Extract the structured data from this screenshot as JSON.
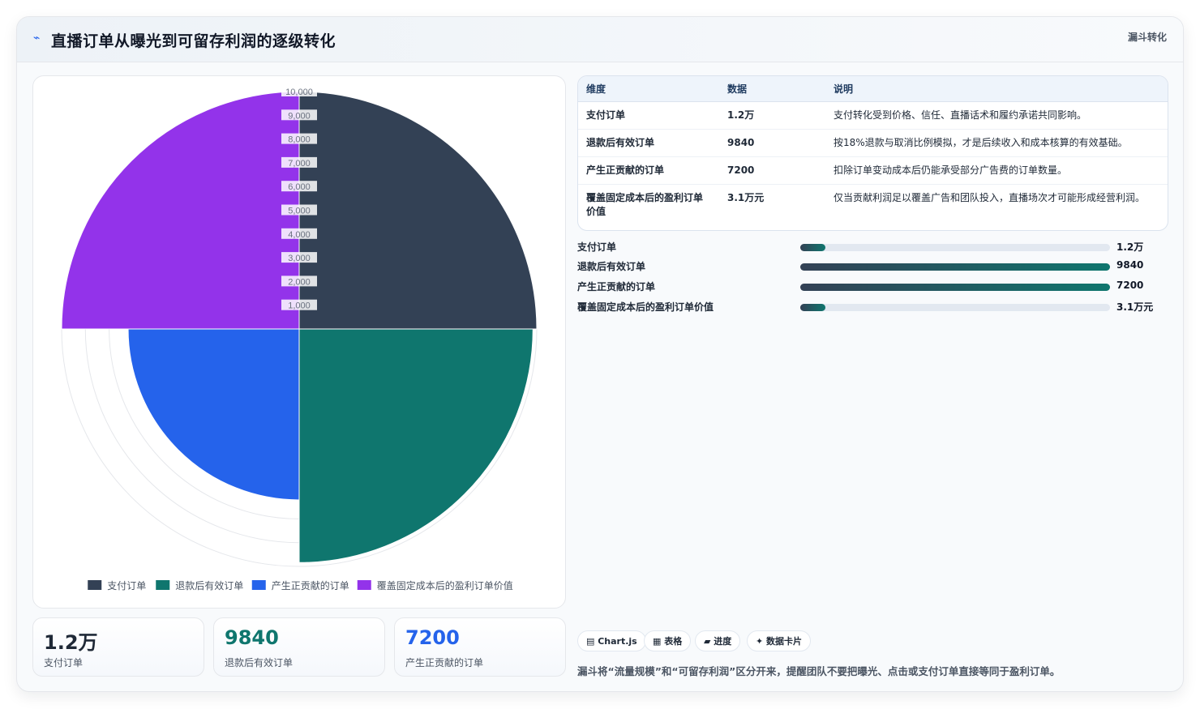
{
  "header": {
    "icon": "chart-icon",
    "title": "直播订单从曝光到可留存利润的逐级转化",
    "badge": "漏斗转化"
  },
  "colors": {
    "series": [
      "#334155",
      "#0f766e",
      "#2563eb",
      "#9333ea"
    ]
  },
  "chart_data": {
    "type": "polar-area",
    "categories": [
      "支付订单",
      "退款后有效订单",
      "产生正贡献的订单",
      "覆盖固定成本后的盈利订单价值"
    ],
    "values": [
      12000,
      9840,
      7200,
      31000
    ],
    "r_ticks": [
      "1,000",
      "2,000",
      "3,000",
      "4,000",
      "5,000",
      "6,000",
      "7,000",
      "8,000",
      "9,000",
      "10,000"
    ],
    "r_max": 10000,
    "legend_position": "bottom"
  },
  "legend": [
    {
      "label": "支付订单",
      "color": "#334155"
    },
    {
      "label": "退款后有效订单",
      "color": "#0f766e"
    },
    {
      "label": "产生正贡献的订单",
      "color": "#2563eb"
    },
    {
      "label": "覆盖固定成本后的盈利订单价值",
      "color": "#9333ea"
    }
  ],
  "stats": [
    {
      "value": "1.2万",
      "label": "支付订单",
      "color": "#1f2937"
    },
    {
      "value": "9840",
      "label": "退款后有效订单",
      "color": "#0f766e"
    },
    {
      "value": "7200",
      "label": "产生正贡献的订单",
      "color": "#2563eb"
    }
  ],
  "table": {
    "headers": [
      "维度",
      "数据",
      "说明"
    ],
    "rows": [
      [
        "支付订单",
        "1.2万",
        "支付转化受到价格、信任、直播话术和履约承诺共同影响。"
      ],
      [
        "退款后有效订单",
        "9840",
        "按18%退款与取消比例模拟，才是后续收入和成本核算的有效基础。"
      ],
      [
        "产生正贡献的订单",
        "7200",
        "扣除订单变动成本后仍能承受部分广告费的订单数量。"
      ],
      [
        "覆盖固定成本后的盈利订单价值",
        "3.1万元",
        "仅当贡献利润足以覆盖广告和团队投入，直播场次才可能形成经营利润。"
      ]
    ]
  },
  "bars": [
    {
      "label": "支付订单",
      "value": "1.2万",
      "fill": 0.08
    },
    {
      "label": "退款后有效订单",
      "value": "9840",
      "fill": 1.0
    },
    {
      "label": "产生正贡献的订单",
      "value": "7200",
      "fill": 1.0
    },
    {
      "label": "覆盖固定成本后的盈利订单价值",
      "value": "3.1万元",
      "fill": 0.08
    }
  ],
  "tags": [
    "▤ Chart.js",
    "▦ 表格",
    "▰ 进度",
    "✦ 数据卡片"
  ],
  "footer": "漏斗将“流量规模”和“可留存利润”区分开来，提醒团队不要把曝光、点击或支付订单直接等同于盈利订单。"
}
